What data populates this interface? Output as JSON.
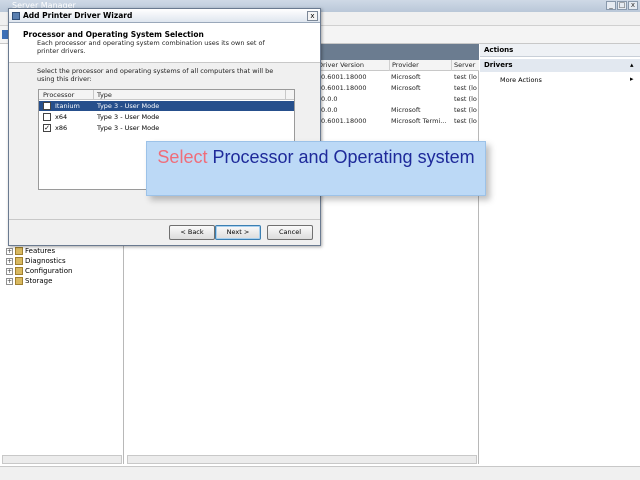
{
  "server_manager": {
    "title": "Server Manager",
    "tree_items": [
      {
        "label": "Features"
      },
      {
        "label": "Diagnostics"
      },
      {
        "label": "Configuration"
      },
      {
        "label": "Storage"
      }
    ],
    "columns": [
      "Driver Version",
      "Provider",
      "Server"
    ],
    "rows": [
      {
        "version": "0.6001.18000",
        "provider": "Microsoft",
        "server": "test (lo"
      },
      {
        "version": "0.6001.18000",
        "provider": "Microsoft",
        "server": "test (lo"
      },
      {
        "version": "0.0.0",
        "provider": "",
        "server": "test (lo"
      },
      {
        "version": "0.0.0",
        "provider": "Microsoft",
        "server": "test (lo"
      },
      {
        "version": "0.6001.18000",
        "provider": "Microsoft Termi...",
        "server": "test (lo"
      }
    ],
    "actions": {
      "header": "Actions",
      "section": "Drivers",
      "more_actions": "More Actions"
    }
  },
  "wizard": {
    "title": "Add Printer Driver Wizard",
    "close_glyph": "x",
    "heading": "Processor and Operating System Selection",
    "subheading": "Each processor and operating system combination uses its own set of printer drivers.",
    "instruction": "Select the processor and operating systems of all computers that will be using this driver:",
    "columns": {
      "processor": "Processor",
      "type": "Type"
    },
    "processors": [
      {
        "name": "Itanium",
        "type": "Type 3 - User Mode",
        "checked": false,
        "selected": true
      },
      {
        "name": "x64",
        "type": "Type 3 - User Mode",
        "checked": false,
        "selected": false
      },
      {
        "name": "x86",
        "type": "Type 3 - User Mode",
        "checked": true,
        "selected": false
      }
    ],
    "buttons": {
      "back": "< Back",
      "next": "Next >",
      "cancel": "Cancel"
    }
  },
  "callout": {
    "lead": "Select",
    "rest": " Processor and Operating system"
  },
  "colors": {
    "selection": "#264f8c",
    "callout_bg": "#bcd9f6",
    "callout_lead": "#ef6d7a",
    "callout_text": "#1e2a9a"
  }
}
